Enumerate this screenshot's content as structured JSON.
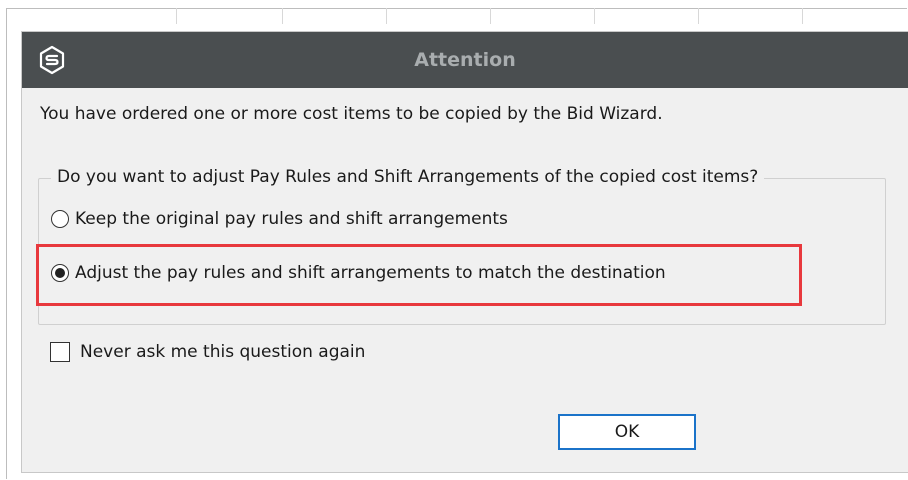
{
  "dialog": {
    "title": "Attention",
    "app_icon": "app-logo-icon",
    "message": "You have ordered one or more cost items to be copied by the Bid Wizard.",
    "question_group": {
      "legend": "Do you want to adjust Pay Rules and Shift Arrangements of the copied cost items?",
      "options": [
        {
          "label": "Keep the original pay rules and shift arrangements",
          "selected": false
        },
        {
          "label": "Adjust the pay rules and shift arrangements to match the destination",
          "selected": true
        }
      ],
      "highlight_color": "#e8383d"
    },
    "never_ask": {
      "label": "Never ask me this question again",
      "checked": false
    },
    "ok_label": "OK",
    "colors": {
      "titlebar": "#4a4e50",
      "title_text": "#a9adaf",
      "button_border": "#1b73c9",
      "background": "#f0f0f0"
    }
  }
}
